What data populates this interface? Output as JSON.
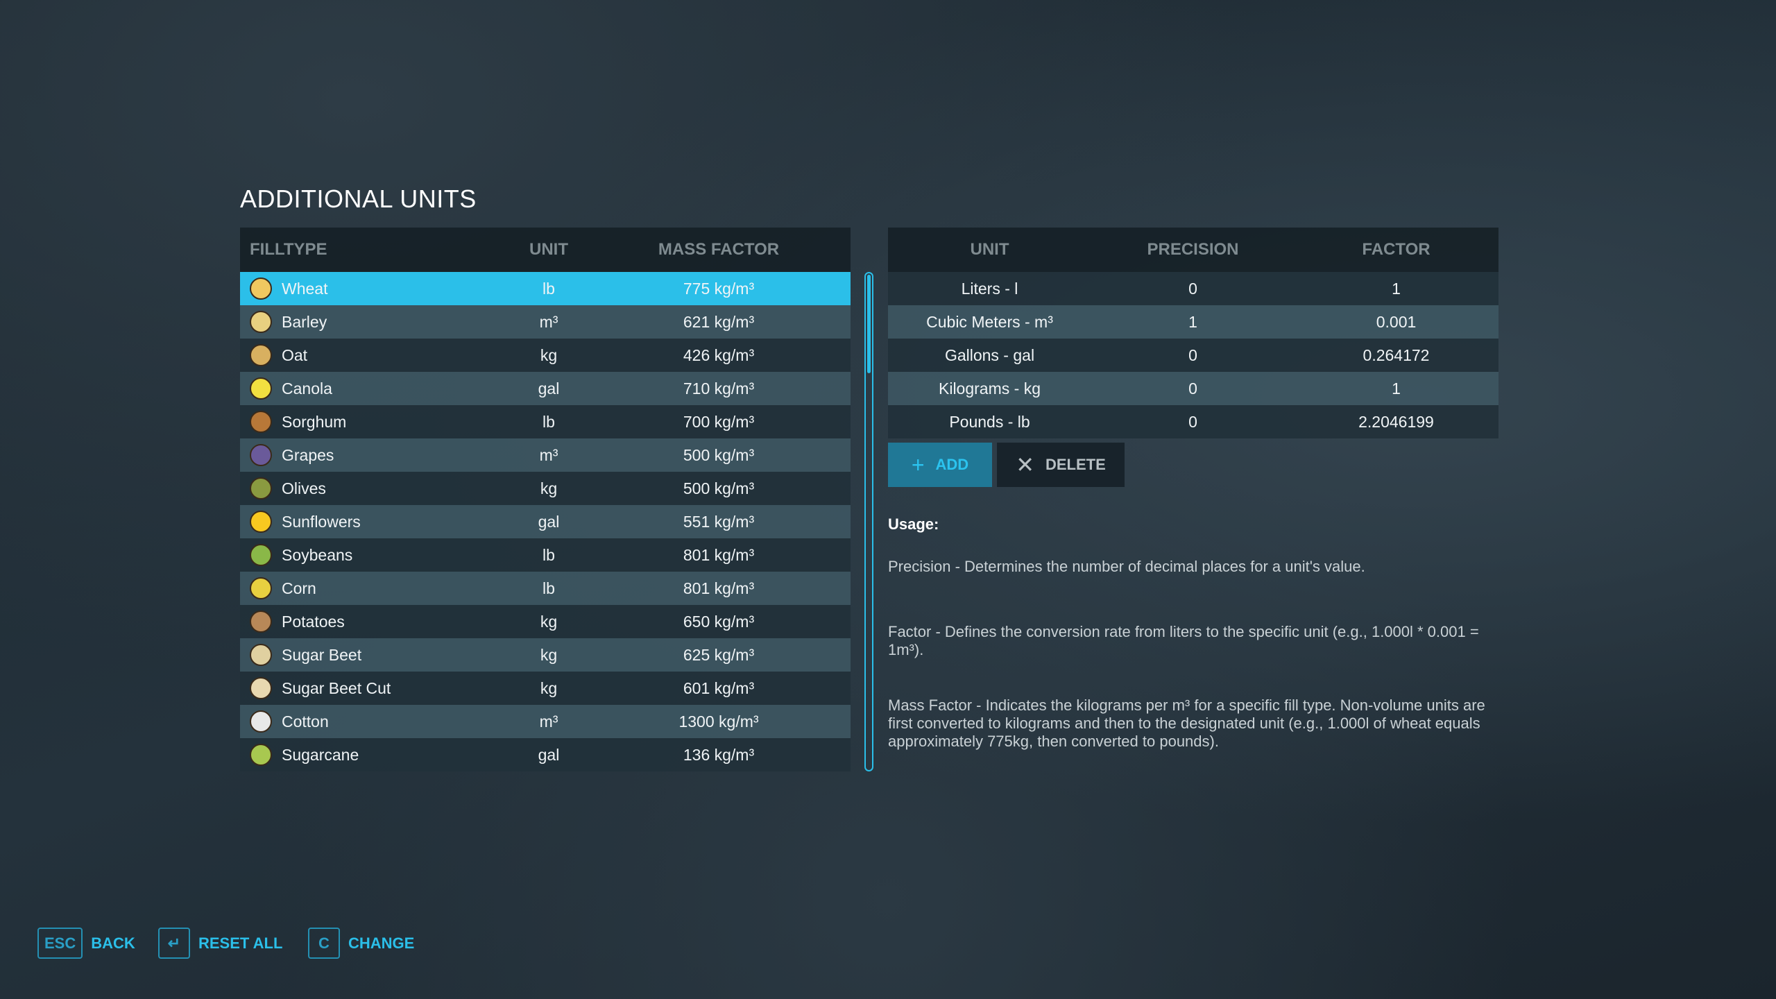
{
  "title": "ADDITIONAL UNITS",
  "filltypes": {
    "headers": [
      "FILLTYPE",
      "UNIT",
      "MASS FACTOR"
    ],
    "rows": [
      {
        "name": "Wheat",
        "unit": "lb",
        "mass": "775 kg/m³",
        "icon": "wheat-icon",
        "color": "#f0c860",
        "selected": true
      },
      {
        "name": "Barley",
        "unit": "m³",
        "mass": "621 kg/m³",
        "icon": "barley-icon",
        "color": "#e8d080"
      },
      {
        "name": "Oat",
        "unit": "kg",
        "mass": "426 kg/m³",
        "icon": "oat-icon",
        "color": "#d8b060"
      },
      {
        "name": "Canola",
        "unit": "gal",
        "mass": "710 kg/m³",
        "icon": "canola-icon",
        "color": "#f2e040"
      },
      {
        "name": "Sorghum",
        "unit": "lb",
        "mass": "700 kg/m³",
        "icon": "sorghum-icon",
        "color": "#b87838"
      },
      {
        "name": "Grapes",
        "unit": "m³",
        "mass": "500 kg/m³",
        "icon": "grapes-icon",
        "color": "#6a5a9a"
      },
      {
        "name": "Olives",
        "unit": "kg",
        "mass": "500 kg/m³",
        "icon": "olives-icon",
        "color": "#8a9a40"
      },
      {
        "name": "Sunflowers",
        "unit": "gal",
        "mass": "551 kg/m³",
        "icon": "sunflower-icon",
        "color": "#f8c820"
      },
      {
        "name": "Soybeans",
        "unit": "lb",
        "mass": "801 kg/m³",
        "icon": "soybeans-icon",
        "color": "#8ab848"
      },
      {
        "name": "Corn",
        "unit": "lb",
        "mass": "801 kg/m³",
        "icon": "corn-icon",
        "color": "#e8d040"
      },
      {
        "name": "Potatoes",
        "unit": "kg",
        "mass": "650 kg/m³",
        "icon": "potato-icon",
        "color": "#b88858"
      },
      {
        "name": "Sugar Beet",
        "unit": "kg",
        "mass": "625 kg/m³",
        "icon": "sugar-beet-icon",
        "color": "#e0d0a0"
      },
      {
        "name": "Sugar Beet Cut",
        "unit": "kg",
        "mass": "601 kg/m³",
        "icon": "sugar-beet-cut-icon",
        "color": "#e8d8b0"
      },
      {
        "name": "Cotton",
        "unit": "m³",
        "mass": "1300 kg/m³",
        "icon": "cotton-icon",
        "color": "#e8e8e8"
      },
      {
        "name": "Sugarcane",
        "unit": "gal",
        "mass": "136 kg/m³",
        "icon": "sugarcane-icon",
        "color": "#a8c850"
      }
    ],
    "scroll_position": 0
  },
  "units": {
    "headers": [
      "UNIT",
      "PRECISION",
      "FACTOR"
    ],
    "rows": [
      {
        "unit": "Liters - l",
        "precision": "0",
        "factor": "1"
      },
      {
        "unit": "Cubic Meters - m³",
        "precision": "1",
        "factor": "0.001"
      },
      {
        "unit": "Gallons - gal",
        "precision": "0",
        "factor": "0.264172"
      },
      {
        "unit": "Kilograms - kg",
        "precision": "0",
        "factor": "1"
      },
      {
        "unit": "Pounds - lb",
        "precision": "0",
        "factor": "2.2046199"
      }
    ],
    "add_label": "ADD",
    "delete_label": "DELETE"
  },
  "usage": {
    "heading": "Usage:",
    "precision": "Precision - Determines the number of decimal places for a unit's value.",
    "factor": "Factor - Defines the conversion rate from liters to the specific unit (e.g., 1.000l * 0.001 = 1m³).",
    "mass_factor": "Mass Factor - Indicates the kilograms per m³ for a specific fill type. Non-volume units are first converted to kilograms and then to the designated unit (e.g., 1.000l of wheat equals approximately 775kg, then converted to pounds)."
  },
  "footer": [
    {
      "key": "ESC",
      "label": "BACK"
    },
    {
      "key": "↵",
      "label": "RESET ALL"
    },
    {
      "key": "C",
      "label": "CHANGE"
    }
  ],
  "colors": {
    "accent": "#2bbfe9",
    "selected_row": "#2bbfe9"
  }
}
